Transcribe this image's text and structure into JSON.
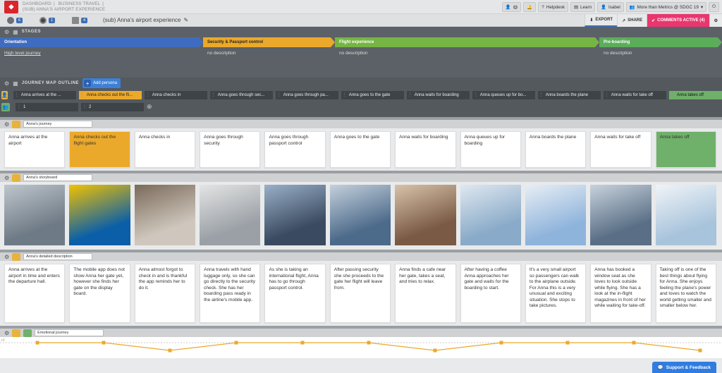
{
  "breadcrumb": {
    "level1": [
      "DASHBOARD",
      "BUSINESS TRAVEL"
    ],
    "level2": "(SUB) ANNA'S AIRPORT EXPERIENCE"
  },
  "topbar": {
    "notifications_count": "1",
    "helpdesk": "Helpdesk",
    "learn": "Learn",
    "user": "Isabel",
    "workspace": "More than Metrics @ SDGC 19"
  },
  "stats": [
    {
      "icon": "persona-icon",
      "value": "6"
    },
    {
      "icon": "touchpoint-icon",
      "value": "1"
    },
    {
      "icon": "map-icon",
      "value": "4"
    }
  ],
  "page_title": "(sub) Anna's airport experience",
  "actions": {
    "export": "EXPORT",
    "share": "SHARE",
    "comments": "COMMENTS ACTIVE (4)"
  },
  "stages_label": "STAGES",
  "stages": [
    {
      "name": "Orientation",
      "desc": "High level journey",
      "color": "#3f6cc0",
      "text": "#ffffff"
    },
    {
      "name": "Security & Passport control",
      "desc": "no description",
      "color": "#eba92b",
      "text": "#222222"
    },
    {
      "name": "Flight experience",
      "desc": "no description",
      "color": "#76b543",
      "text": "#ffffff"
    },
    {
      "name": "Pre-boarding",
      "desc": "no description",
      "color": "#5cad5a",
      "text": "#ffffff"
    }
  ],
  "outline": {
    "label": "JOURNEY MAP OUTLINE",
    "add_persona": "Add persona",
    "steps": [
      {
        "label": "Anna arrives at the ...",
        "style": ""
      },
      {
        "label": "Anna checks out the fli...",
        "style": "orange"
      },
      {
        "label": "Anna checks in",
        "style": ""
      },
      {
        "label": "Anna goes through sec...",
        "style": ""
      },
      {
        "label": "Anna goes through pa...",
        "style": ""
      },
      {
        "label": "Anna goes to the gate",
        "style": ""
      },
      {
        "label": "Anna waits for boarding",
        "style": ""
      },
      {
        "label": "Anna queues up for bo...",
        "style": ""
      },
      {
        "label": "Anna boards the plane",
        "style": ""
      },
      {
        "label": "Anna waits for take off",
        "style": ""
      },
      {
        "label": "Anna takes off",
        "style": "green"
      }
    ],
    "rows": [
      "1",
      "2"
    ]
  },
  "lanes": {
    "journey": {
      "name": "Anna's journey",
      "cards": [
        {
          "text": "Anna arrives at the airport",
          "style": ""
        },
        {
          "text": "Anna checks out the flight gates",
          "style": "orange"
        },
        {
          "text": "Anna checks in",
          "style": ""
        },
        {
          "text": "Anna goes through security",
          "style": ""
        },
        {
          "text": "Anna goes through passport control",
          "style": ""
        },
        {
          "text": "Anna goes to the gate",
          "style": ""
        },
        {
          "text": "Anna waits for boarding",
          "style": ""
        },
        {
          "text": "Anna queues up for boarding",
          "style": ""
        },
        {
          "text": "Anna boards the plane",
          "style": ""
        },
        {
          "text": "Anna waits for take off",
          "style": ""
        },
        {
          "text": "Anna takes off",
          "style": "green"
        }
      ]
    },
    "storyboard": {
      "name": "Anna's storyboard",
      "photos": [
        "airport-hall",
        "departures-board",
        "check-in-desk",
        "security-scanner",
        "passport-control",
        "terminal-walkway",
        "cafe-seat",
        "gate-window",
        "boarding-stairs",
        "plane-cabin",
        "plane-takeoff"
      ]
    },
    "description": {
      "name": "Anna's detailed description",
      "cards": [
        "Anna arrives at the airport in time and enters the departure hall.",
        "The mobile app does not show Anna her gate yet, however she finds her gate on the display board.",
        "Anna almost forgot to check in and is thankful the app reminds her to do it.",
        "Anna travels with hand luggage only, so she can go directly to the security check. She has her boarding pass ready in the airline's mobile app.",
        "As she is taking an international flight, Anna has to go through passport control.",
        "After passing security she she proceeds to the gate her flight will leave from.",
        "Anna finds a cafe near her gate, takes a seat, and tries to relax.",
        "After having a coffee Anna approaches her gate and waits for the boarding to start.",
        "It's a very small airport so passengers can walk to the airplane outside. For Anna this is a very unusual and exciting situation. She stops to take pictures.",
        "Anna has booked a window seat as she loves to look outside while flying. She has a look at the in-flight magazines in front of her while waiting for take-off.",
        "Taking off is one of the best things about flying for Anna. She enjoys feeling the plane's power and loves to watch the world getting smaller and smaller below her."
      ]
    },
    "emotional": {
      "name": "Emotional journey",
      "axis_label": "+2",
      "levels": [
        2,
        2,
        1,
        2,
        2,
        2,
        1,
        2,
        2,
        2,
        1
      ]
    }
  },
  "support": "Support & Feedback"
}
